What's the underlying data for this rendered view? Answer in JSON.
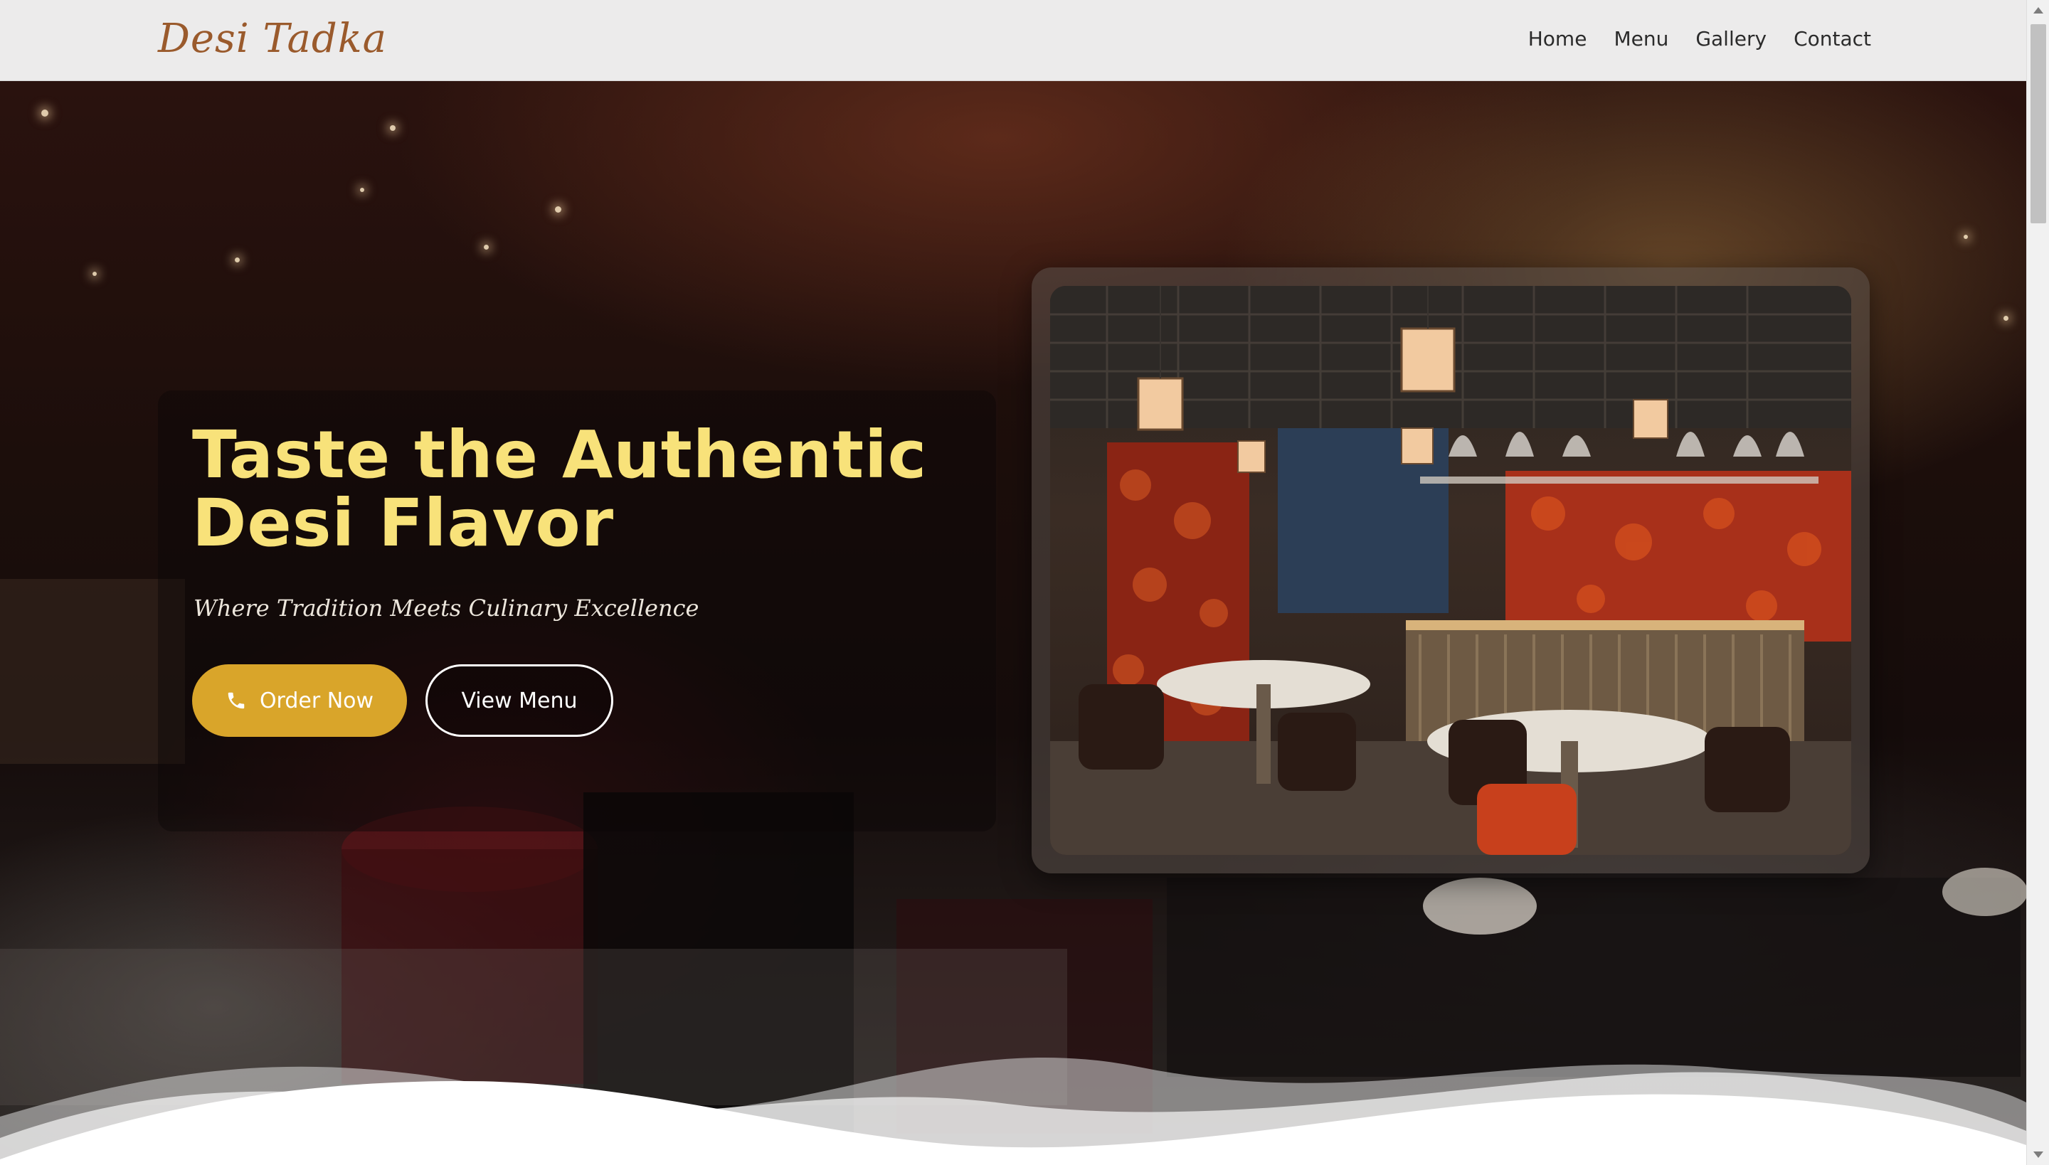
{
  "brand": {
    "logo_text": "Desi Tadka"
  },
  "nav": {
    "items": [
      {
        "label": "Home"
      },
      {
        "label": "Menu"
      },
      {
        "label": "Gallery"
      },
      {
        "label": "Contact"
      }
    ]
  },
  "hero": {
    "headline_line1": "Taste the Authentic",
    "headline_line2": "Desi Flavor",
    "tagline": "Where Tradition Meets Culinary Excellence",
    "order_button": {
      "label": "Order Now",
      "icon": "phone-icon"
    },
    "menu_button": {
      "label": "View Menu"
    }
  },
  "colors": {
    "headline": "#f8e27a",
    "accent_button": "#d9a52a",
    "logo": "#9a5a2c",
    "nav_bg": "#ecebeb"
  }
}
